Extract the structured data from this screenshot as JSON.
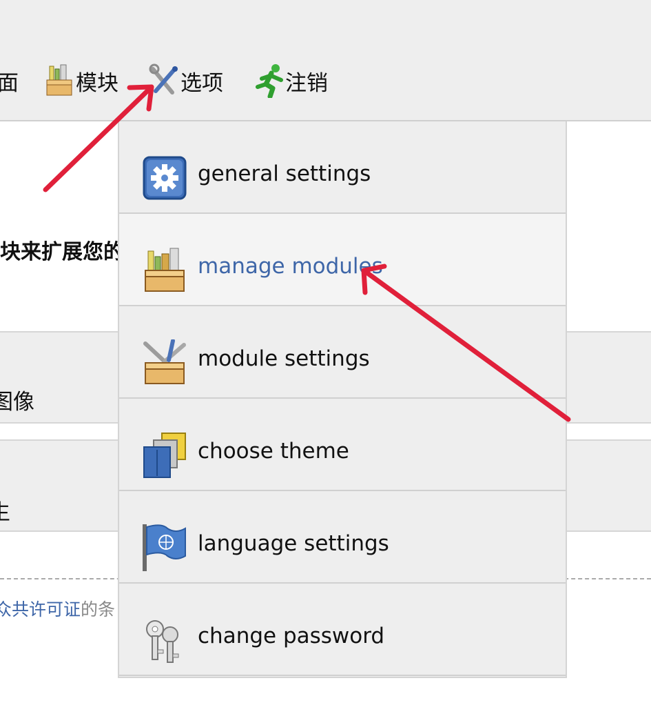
{
  "menubar": {
    "items": [
      {
        "label": "面",
        "icon": "page-icon"
      },
      {
        "label": "模块",
        "icon": "modules-box-icon"
      },
      {
        "label": "选项",
        "icon": "tools-icon"
      },
      {
        "label": "注销",
        "icon": "running-man-icon"
      }
    ]
  },
  "background": {
    "heading": "块来扩展您的",
    "band1_text": "图像",
    "band2_text": "生",
    "footer_link": "众共许可证",
    "footer_text": "的条"
  },
  "dropdown": {
    "items": [
      {
        "label": "general settings",
        "icon": "gear-icon"
      },
      {
        "label": "manage modules",
        "icon": "modules-box-icon",
        "highlighted": true
      },
      {
        "label": "module settings",
        "icon": "tools-box-icon"
      },
      {
        "label": "choose theme",
        "icon": "theme-shirts-icon"
      },
      {
        "label": "language settings",
        "icon": "flag-icon"
      },
      {
        "label": "change password",
        "icon": "keys-icon"
      }
    ]
  },
  "colors": {
    "menubar_bg": "#eeeeee",
    "highlight_text": "#3e66a8",
    "annotation_arrow": "#e0203a"
  }
}
